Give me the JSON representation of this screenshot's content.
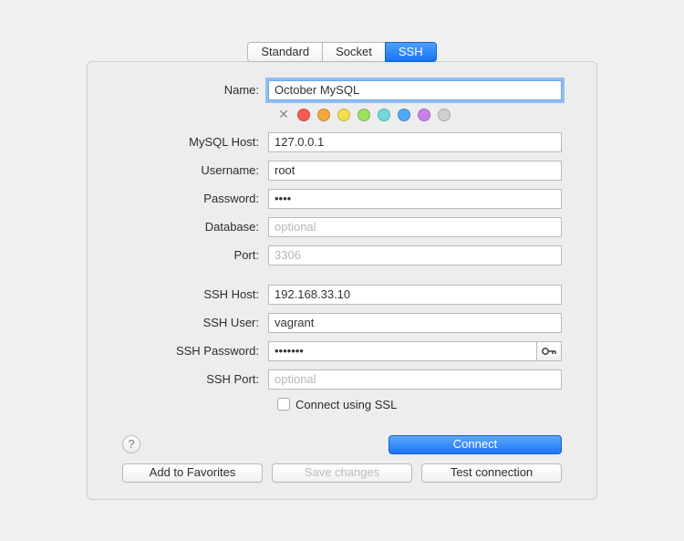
{
  "tabs": {
    "standard": "Standard",
    "socket": "Socket",
    "ssh": "SSH"
  },
  "labels": {
    "name": "Name:",
    "mysql_host": "MySQL Host:",
    "username": "Username:",
    "password": "Password:",
    "database": "Database:",
    "port": "Port:",
    "ssh_host": "SSH Host:",
    "ssh_user": "SSH User:",
    "ssh_password": "SSH Password:",
    "ssh_port": "SSH Port:",
    "ssl": "Connect using SSL"
  },
  "fields": {
    "name": "October MySQL",
    "mysql_host": "127.0.0.1",
    "username": "root",
    "password": "••••",
    "database": "",
    "port": "",
    "ssh_host": "192.168.33.10",
    "ssh_user": "vagrant",
    "ssh_password": "•••••••",
    "ssh_port": ""
  },
  "placeholders": {
    "database": "optional",
    "port": "3306",
    "ssh_port": "optional"
  },
  "colors": {
    "red": "#f55c4f",
    "orange": "#f7a63c",
    "yellow": "#f4dd4e",
    "green": "#9de05c",
    "teal": "#6fd8e0",
    "blue": "#4faaf6",
    "purple": "#c881e6",
    "gray": "#cfcfcf"
  },
  "buttons": {
    "help": "?",
    "connect": "Connect",
    "add_fav": "Add to Favorites",
    "save": "Save changes",
    "test": "Test connection"
  }
}
